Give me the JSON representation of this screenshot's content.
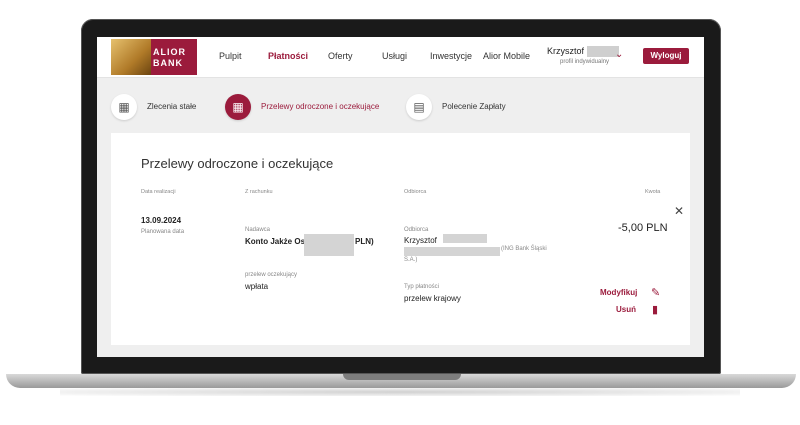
{
  "header": {
    "brand_line1": "ALIOR",
    "brand_line2": "BANK",
    "nav": [
      "Pulpit",
      "Płatności",
      "Oferty",
      "Usługi",
      "Inwestycje",
      "Alior Mobile"
    ],
    "user_name": "Krzysztof",
    "user_profile": "profil indywidualny",
    "logout_label": "Wyloguj"
  },
  "tabs": [
    {
      "label": "Zlecenia stałe"
    },
    {
      "label": "Przelewy odroczone i oczekujące"
    },
    {
      "label": "Polecenie Zapłaty"
    }
  ],
  "card": {
    "title": "Przelewy odroczone i oczekujące",
    "headers": {
      "date": "Data realizacji",
      "from": "Z rachunku",
      "to": "Odbiorca",
      "amount": "Kwota"
    },
    "row": {
      "date": "13.09.2024",
      "date_sub": "Planowana data",
      "sender_label": "Nadawca",
      "sender_value_prefix": "Konto Jakże Osobiste",
      "sender_value_suffix": "PLN)",
      "recipient_label": "Odbiorca",
      "recipient_name": "Krzysztof",
      "recipient_bank": "(ING Bank Śląski",
      "recipient_bank2": "S.A.)",
      "pending_label": "przelew oczekujący",
      "pending_value": "wpłata",
      "type_label": "Typ płatności",
      "type_value": "przelew krajowy",
      "amount": "-5,00 PLN",
      "modify_label": "Modyfikuj",
      "delete_label": "Usuń"
    }
  },
  "colors": {
    "accent": "#9b1b3c"
  }
}
